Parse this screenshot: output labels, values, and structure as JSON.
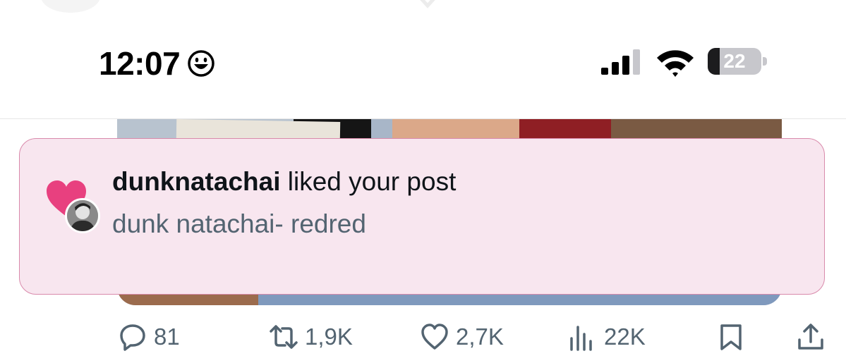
{
  "status_bar": {
    "time": "12:07",
    "battery_level": "22",
    "battery_fraction": 0.22,
    "icons": [
      "smiley-face-icon",
      "cellular-signal-icon",
      "wifi-icon",
      "battery-icon"
    ]
  },
  "notification": {
    "username": "dunknatachai",
    "action_text": " liked your post",
    "post_title": "dunk natachai- redred",
    "icons": [
      "heart-icon",
      "avatar"
    ],
    "colors": {
      "background": "#f8e6ef",
      "border": "#d98aab",
      "heart": "#e8407f"
    }
  },
  "actions": {
    "replies": "81",
    "reposts": "1,9K",
    "likes": "2,7K",
    "views": "22K",
    "icons": [
      "reply-icon",
      "repost-icon",
      "like-icon",
      "views-icon",
      "bookmark-icon",
      "share-icon"
    ]
  },
  "colors": {
    "muted_text": "#536471",
    "primary_text": "#0f1419"
  }
}
